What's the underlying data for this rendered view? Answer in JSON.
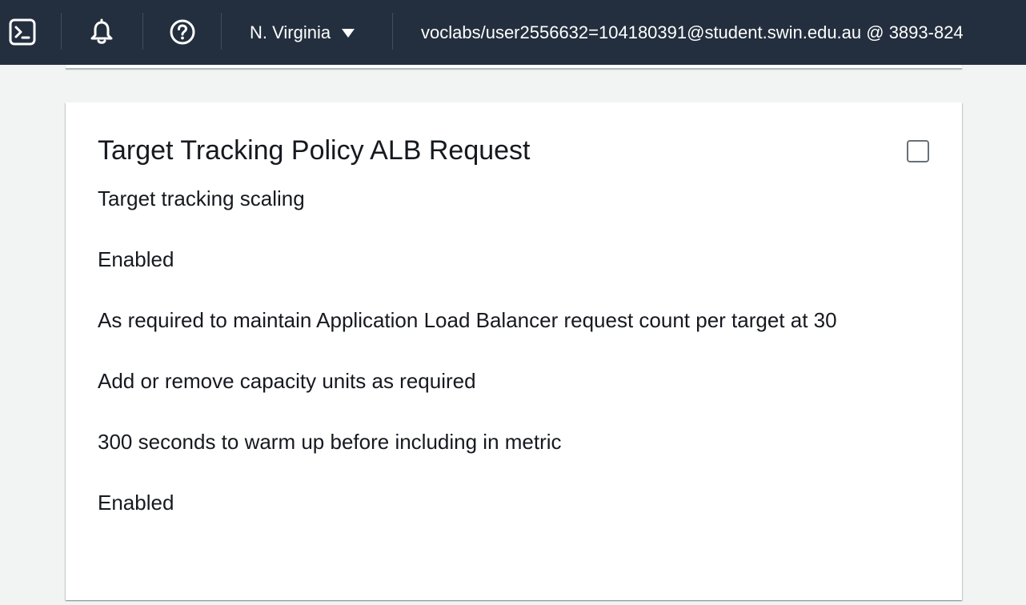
{
  "topbar": {
    "icons": {
      "cloudshell": "cloudshell-icon",
      "notifications": "bell-icon",
      "help": "help-icon"
    },
    "region": "N. Virginia",
    "account": "voclabs/user2556632=104180391@student.swin.edu.au @ 3893-824"
  },
  "policy_card": {
    "title": "Target Tracking Policy ALB Request",
    "lines": [
      "Target tracking scaling",
      "Enabled",
      "As required to maintain Application Load Balancer request count per target at 30",
      "Add or remove capacity units as required",
      "300 seconds to warm up before including in metric",
      "Enabled"
    ]
  },
  "colors": {
    "topbar_bg": "#232f3e",
    "page_bg": "#f2f3f3",
    "card_bg": "#ffffff",
    "text": "#16191f"
  }
}
